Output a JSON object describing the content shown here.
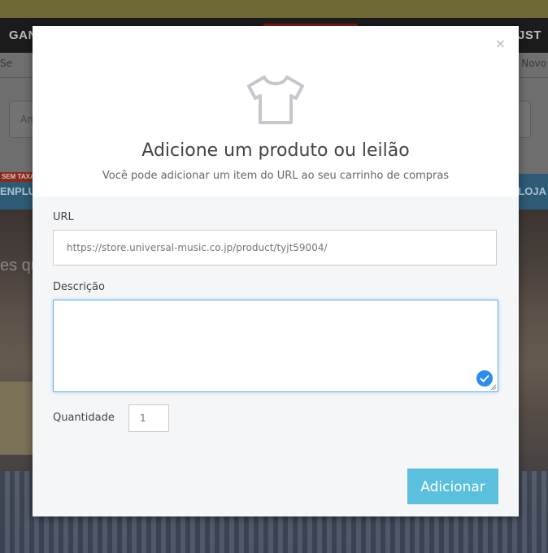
{
  "background": {
    "nav_left": "GAN",
    "nav_right": "JST",
    "subnav_left": "Se",
    "subnav_right": "Novo",
    "search_text": "Am",
    "badge": "SEM TAXA",
    "bluebar_left": "ENPLU",
    "bluebar_right": "S LOJA",
    "photo_text": "es qu"
  },
  "modal": {
    "close_label": "×",
    "icon": "tshirt-icon",
    "title": "Adicione um produto ou leilão",
    "subtitle": "Você pode adicionar um item do URL ao seu carrinho de compras",
    "url_label": "URL",
    "url_value": "https://store.universal-music.co.jp/product/tyjt59004/",
    "description_label": "Descrição",
    "description_value": "",
    "quantity_label": "Quantidade",
    "quantity_value": "1",
    "submit_label": "Adicionar"
  },
  "colors": {
    "accent_button": "#5bc0de",
    "focus_border": "#66afe9",
    "check_badge": "#2d8cf0"
  }
}
